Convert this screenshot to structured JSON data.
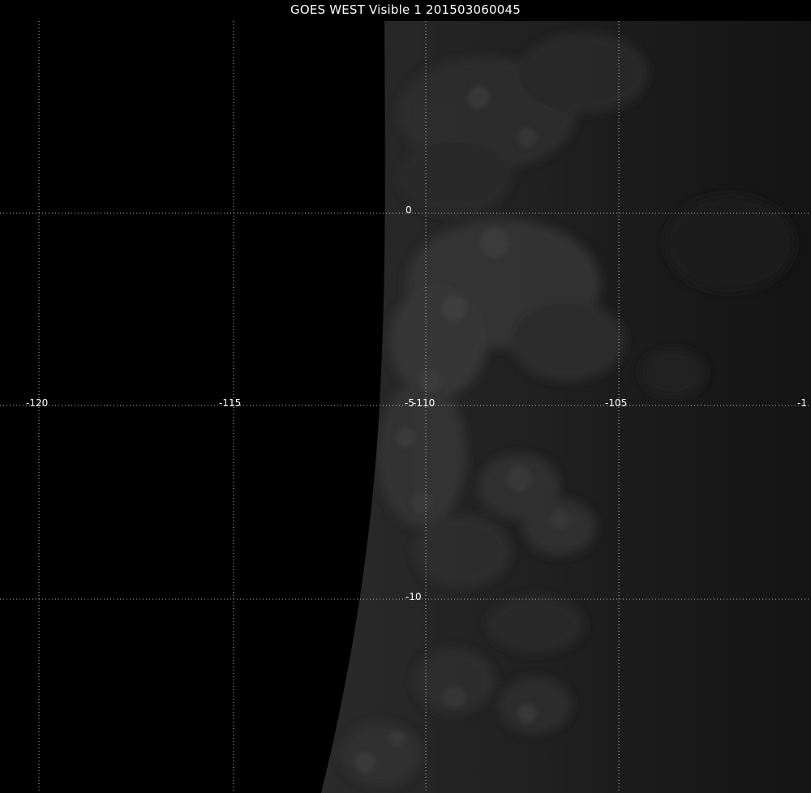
{
  "title": "GOES WEST Visible 1 201503060045",
  "grid": {
    "color": "#bdbdbd",
    "lon_labels": [
      "-120",
      "-115",
      "-110",
      "-105",
      "-1"
    ],
    "lat_labels": [
      "0",
      "-10"
    ],
    "overlap_label": "-5"
  },
  "imagery": {
    "space_color": "#000000",
    "earth_color": "#1e1e1e"
  }
}
